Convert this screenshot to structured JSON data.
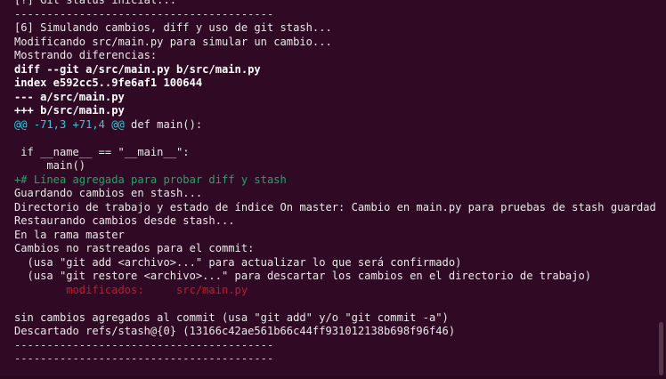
{
  "terminal": {
    "lines": [
      {
        "text": "[?] Git status inicial...",
        "kind": "plain"
      },
      {
        "text": "----------------------------------------",
        "kind": "sep"
      },
      {
        "text": "[6] Simulando cambios, diff y uso de git stash...",
        "kind": "plain"
      },
      {
        "text": "Modificando src/main.py para simular un cambio...",
        "kind": "plain"
      },
      {
        "text": "Mostrando diferencias:",
        "kind": "plain"
      },
      {
        "text": "diff --git a/src/main.py b/src/main.py",
        "kind": "bold"
      },
      {
        "text": "index e592cc5..9fe6af1 100644",
        "kind": "bold"
      },
      {
        "text": "--- a/src/main.py",
        "kind": "bold"
      },
      {
        "text": "+++ b/src/main.py",
        "kind": "bold"
      },
      {
        "text": "",
        "kind": "hunk",
        "hunk_range": "@@ -71,3 +71,4 @@",
        "hunk_context": " def main():"
      },
      {
        "text": "",
        "kind": "plain"
      },
      {
        "text": " if __name__ == \"__main__\":",
        "kind": "plain"
      },
      {
        "text": "     main()",
        "kind": "plain"
      },
      {
        "text": "+# Línea agregada para probar diff y stash",
        "kind": "add"
      },
      {
        "text": "Guardando cambios en stash...",
        "kind": "plain"
      },
      {
        "text": "Directorio de trabajo y estado de índice On master: Cambio en main.py para pruebas de stash guardados",
        "kind": "plain"
      },
      {
        "text": "Restaurando cambios desde stash...",
        "kind": "plain"
      },
      {
        "text": "En la rama master",
        "kind": "plain"
      },
      {
        "text": "Cambios no rastreados para el commit:",
        "kind": "plain"
      },
      {
        "text": "  (usa \"git add <archivo>...\" para actualizar lo que será confirmado)",
        "kind": "plain"
      },
      {
        "text": "  (usa \"git restore <archivo>...\" para descartar los cambios en el directorio de trabajo)",
        "kind": "plain"
      },
      {
        "text": "        modificados:     src/main.py",
        "kind": "del"
      },
      {
        "text": "",
        "kind": "plain"
      },
      {
        "text": "sin cambios agregados al commit (usa \"git add\" y/o \"git commit -a\")",
        "kind": "plain"
      },
      {
        "text": "Descartado refs/stash@{0} (13166c42ae561b66c44ff931012138b698f96f46)",
        "kind": "plain"
      },
      {
        "text": "----------------------------------------",
        "kind": "sep"
      },
      {
        "text": "----------------------------------------",
        "kind": "sep"
      }
    ]
  },
  "colors": {
    "background": "#300a24",
    "foreground": "#e8e8e8",
    "hunk": "#33c7de",
    "added": "#26a269",
    "removed": "#c01c28"
  }
}
